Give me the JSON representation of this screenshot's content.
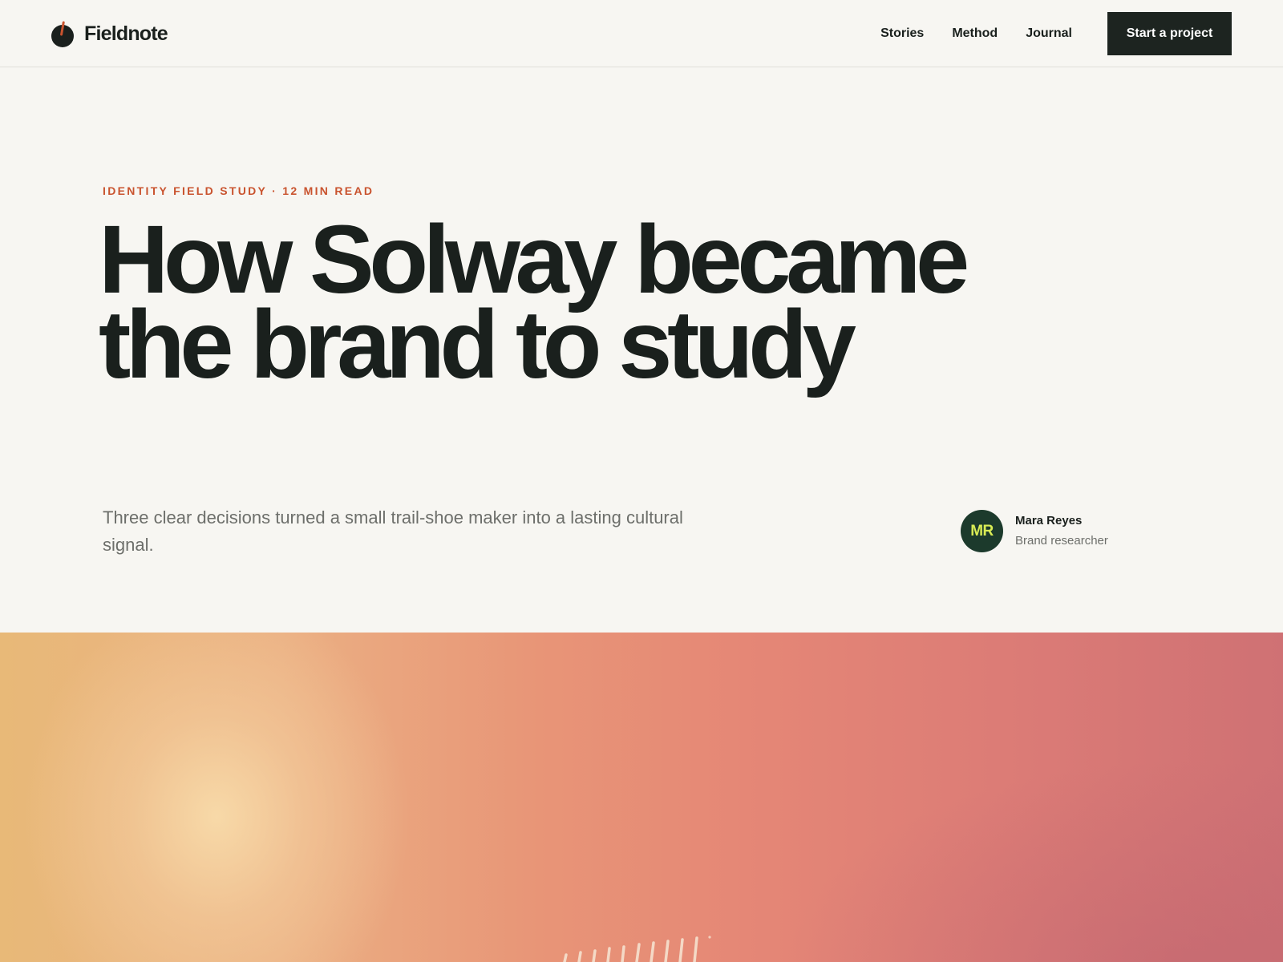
{
  "brand": {
    "name": "Fieldnote",
    "mark_icon": "fieldnote-logo-mark"
  },
  "nav": {
    "items": [
      {
        "label": "Stories"
      },
      {
        "label": "Method"
      },
      {
        "label": "Journal"
      }
    ],
    "cta_label": "Start a project"
  },
  "article": {
    "eyebrow": "IDENTITY FIELD STUDY · 12 MIN READ",
    "headline": "How Solway became the brand to study",
    "dek": "Three clear decisions turned a small trail-shoe maker into a lasting cultural signal.",
    "author": {
      "initials": "MR",
      "name": "Mara Reyes",
      "role": "Brand researcher"
    }
  },
  "colors": {
    "accent": "#c9532e",
    "ink": "#1a201d",
    "background": "#f7f6f2",
    "button": "#1d2420",
    "avatar_bg": "#1c3a2c",
    "avatar_text": "#d9ec55"
  }
}
